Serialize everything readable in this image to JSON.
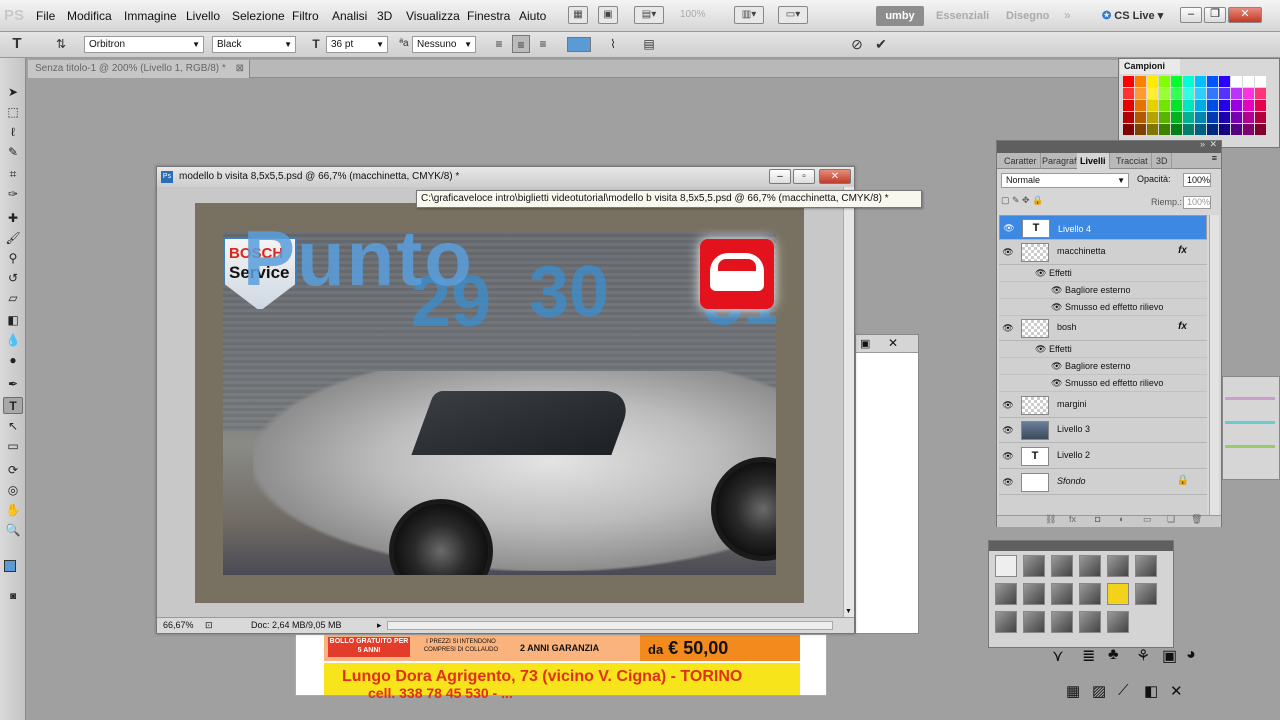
{
  "app": {
    "logo": "PS"
  },
  "menubar": {
    "items": [
      "File",
      "Modifica",
      "Immagine",
      "Livello",
      "Selezione",
      "Filtro",
      "Analisi",
      "3D",
      "Visualizza",
      "Finestra",
      "Aiuto"
    ],
    "zoom": "100%",
    "workspaces": [
      "umby",
      "Essenziali",
      "Disegno"
    ],
    "cs_live": "CS Live"
  },
  "options": {
    "font_family": "Orbitron",
    "font_style": "Black",
    "font_size": "36 pt",
    "antialias": "Nessuno"
  },
  "doc_tab": {
    "label": "Senza titolo-1 @ 200% (Livello 1, RGB/8) *"
  },
  "document": {
    "title": "modello b visita 8,5x5,5.psd @ 66,7% (macchinetta, CMYK/8) *",
    "zoom": "66,67%",
    "doc_info": "Doc: 2,64 MB/9,05 MB",
    "tooltip": "C:\\graficaveloce intro\\biglietti videotutorial\\modello b visita 8,5x5,5.psd @ 66,7% (macchinetta, CMYK/8) *"
  },
  "artwork": {
    "punto": "Punto",
    "bosch": "BOSCH",
    "service": "Service",
    "numbers": [
      "29",
      "30",
      "31"
    ]
  },
  "flyer": {
    "bollo": "BOLLO GRATUITO PER 5 ANNI",
    "prezzi": "I PREZZI SI INTENDONO COMPRESI DI COLLAUDO",
    "garanzia": "2 ANNI GARANZIA",
    "price_prefix": "da",
    "price": "€ 50,00",
    "address": "Lungo Dora Agrigento, 73 (vicino V. Cigna) - TORINO",
    "cell": "cell. 338 78 45 530 - ..."
  },
  "campioni": {
    "title": "Campioni"
  },
  "layers_panel": {
    "tabs": [
      "Caratter",
      "Paragraf",
      "Livelli",
      "Tracciat",
      "3D"
    ],
    "active_tab": "Livelli",
    "blend_mode": "Normale",
    "opacity_label": "Opacità:",
    "opacity": "100%",
    "fill_label": "Riemp.:",
    "fill": "100%",
    "layers": [
      {
        "name": "Livello 4"
      },
      {
        "name": "macchinetta"
      },
      {
        "name": "Effetti"
      },
      {
        "name": "Bagliore esterno"
      },
      {
        "name": "Smusso ed effetto rilievo"
      },
      {
        "name": "bosh"
      },
      {
        "name": "Effetti"
      },
      {
        "name": "Bagliore esterno"
      },
      {
        "name": "Smusso ed effetto rilievo"
      },
      {
        "name": "margini"
      },
      {
        "name": "Livello 3"
      },
      {
        "name": "Livello 2"
      },
      {
        "name": "Sfondo"
      }
    ]
  }
}
